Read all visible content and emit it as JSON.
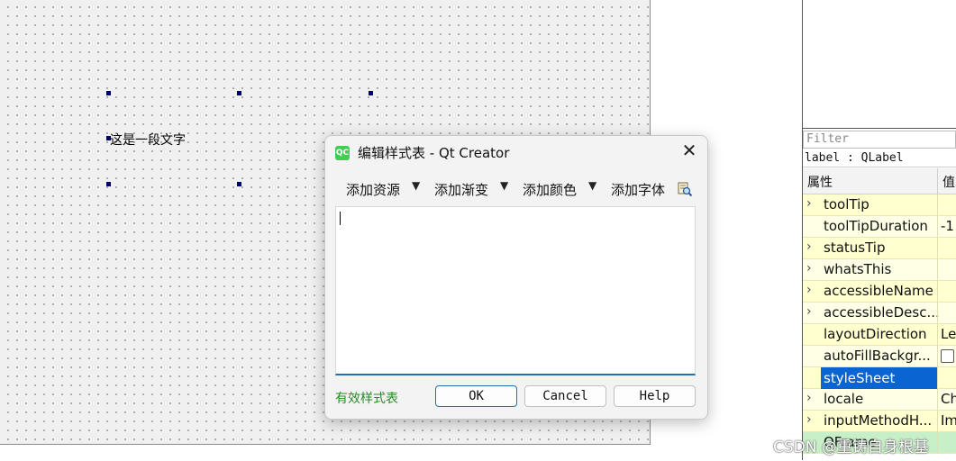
{
  "canvas": {
    "label_text": "这是一段文字"
  },
  "property_editor": {
    "filter_placeholder": "Filter",
    "object_label": "label : QLabel",
    "col_property": "属性",
    "col_value": "值",
    "rows": [
      {
        "name": "toolTip",
        "expandable": true,
        "value": ""
      },
      {
        "name": "toolTipDuration",
        "expandable": false,
        "value": "-1"
      },
      {
        "name": "statusTip",
        "expandable": true,
        "value": ""
      },
      {
        "name": "whatsThis",
        "expandable": true,
        "value": ""
      },
      {
        "name": "accessibleName",
        "expandable": true,
        "value": ""
      },
      {
        "name": "accessibleDesc...",
        "expandable": true,
        "value": ""
      },
      {
        "name": "layoutDirection",
        "expandable": false,
        "value": "Le"
      },
      {
        "name": "autoFillBackgr...",
        "expandable": false,
        "value": "",
        "checkbox": true,
        "checked": false
      },
      {
        "name": "styleSheet",
        "expandable": false,
        "value": "",
        "selected": true
      },
      {
        "name": "locale",
        "expandable": true,
        "value": "Ch"
      },
      {
        "name": "inputMethodH...",
        "expandable": true,
        "value": "Im"
      },
      {
        "name": "QFrame",
        "expandable": false,
        "value": ""
      }
    ]
  },
  "dialog": {
    "logo_text": "QC",
    "title": "编辑样式表 - Qt Creator",
    "toolbar": {
      "add_resource": "添加资源",
      "add_gradient": "添加渐变",
      "add_color": "添加颜色",
      "add_font": "添加字体"
    },
    "editor_value": "",
    "status": "有效样式表",
    "buttons": {
      "ok": "OK",
      "cancel": "Cancel",
      "help": "Help"
    }
  },
  "watermark": "CSDN @重铸自身根基",
  "colors": {
    "accent": "#1f6fb6",
    "selection": "#0a64d2",
    "property_row": "#ffffd0",
    "valid_text": "#2a8a2a"
  }
}
